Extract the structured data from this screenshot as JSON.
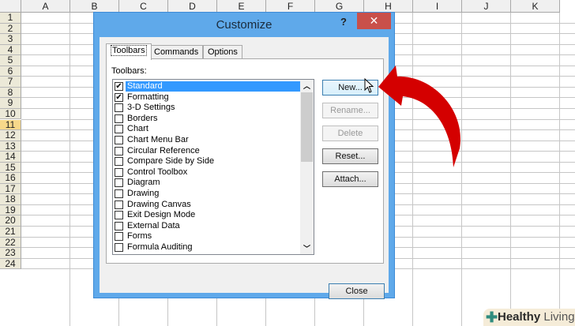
{
  "spreadsheet": {
    "columns": [
      "A",
      "B",
      "C",
      "D",
      "E",
      "F",
      "G",
      "H",
      "I",
      "J",
      "K"
    ],
    "rows": [
      "1",
      "2",
      "3",
      "4",
      "5",
      "6",
      "7",
      "8",
      "9",
      "10",
      "11",
      "12",
      "13",
      "14",
      "15",
      "16",
      "17",
      "18",
      "19",
      "20",
      "21",
      "22",
      "23",
      "24"
    ],
    "selected_row": "11"
  },
  "dialog": {
    "title": "Customize",
    "help": "?",
    "close": "✕",
    "tabs": [
      {
        "label": "Toolbars"
      },
      {
        "label": "Commands"
      },
      {
        "label": "Options"
      }
    ],
    "toolbars_label": "Toolbars:",
    "items": [
      {
        "label": "Standard",
        "checked": true
      },
      {
        "label": "Formatting",
        "checked": true
      },
      {
        "label": "3-D Settings",
        "checked": false
      },
      {
        "label": "Borders",
        "checked": false
      },
      {
        "label": "Chart",
        "checked": false
      },
      {
        "label": "Chart Menu Bar",
        "checked": false
      },
      {
        "label": "Circular Reference",
        "checked": false
      },
      {
        "label": "Compare Side by Side",
        "checked": false
      },
      {
        "label": "Control Toolbox",
        "checked": false
      },
      {
        "label": "Diagram",
        "checked": false
      },
      {
        "label": "Drawing",
        "checked": false
      },
      {
        "label": "Drawing Canvas",
        "checked": false
      },
      {
        "label": "Exit Design Mode",
        "checked": false
      },
      {
        "label": "External Data",
        "checked": false
      },
      {
        "label": "Forms",
        "checked": false
      },
      {
        "label": "Formula Auditing",
        "checked": false
      }
    ],
    "buttons": {
      "new": "New...",
      "rename": "Rename...",
      "delete": "Delete",
      "reset": "Reset...",
      "attach": "Attach...",
      "close": "Close"
    }
  },
  "watermark": {
    "brand1": "Healthy",
    "brand2": "Living"
  },
  "colors": {
    "arrow": "#d40000",
    "titlebar": "#5fa9ea",
    "close": "#c9504a"
  }
}
